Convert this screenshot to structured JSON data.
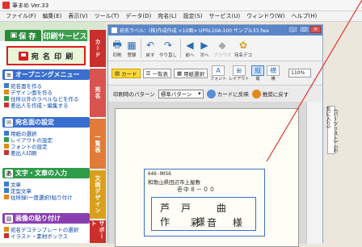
{
  "titlebar": {
    "title": "筆まめ Ver.33"
  },
  "menu": [
    "ファイル(F)",
    "編集(E)",
    "表示(V)",
    "ツール(T)",
    "データ(D)",
    "宛名(L)",
    "設定(S)",
    "サービス(U)",
    "ウィンドウ(W)",
    "ヘルプ(H)"
  ],
  "left": {
    "tab_save": "保 存",
    "tab_print": "印刷サービス",
    "print_button": "宛 名 印 刷",
    "opening_menu": {
      "title": "オープニングメニュー",
      "items": [
        "宛名面を作る",
        "デザイン面を作る",
        "住所以外のラベルなどを作る",
        "差出人を作成・編集する"
      ]
    },
    "address_settings": {
      "title": "宛名面の設定",
      "items": [
        "用紙の選択",
        "レイアウトの設定",
        "フォントの設定",
        "差出人印刷"
      ]
    },
    "text_section": {
      "title": "文字・文章の入力",
      "items": [
        "文章",
        "定型文章",
        "住所録(一度選択)貼り付け"
      ]
    },
    "image_section": {
      "title": "画像の貼り付け",
      "items": [
        "宛名デコテンプレートの選択",
        "イラスト・素材ボックス"
      ]
    },
    "vtabs": [
      "カード",
      "宛名",
      "一覧表",
      "文面デザイン",
      "サポート"
    ]
  },
  "doc": {
    "title": "宛名ラベル：(株)作成作成 <10面> UPRL10A-100 サンプル33.fwa",
    "toolbar": [
      {
        "label": "印刷",
        "icon": "printer-icon",
        "glyph": "🖶",
        "enabled": true
      },
      {
        "label": "登録",
        "icon": "register-icon",
        "glyph": "▦",
        "enabled": true
      },
      {
        "label": "戻す",
        "icon": "undo-icon",
        "glyph": "↶",
        "enabled": true
      },
      {
        "label": "やり直し",
        "icon": "redo-icon",
        "glyph": "↷",
        "enabled": true
      },
      {
        "label": "前へ",
        "icon": "prev-icon",
        "glyph": "◀",
        "enabled": true
      },
      {
        "label": "次へ",
        "icon": "next-icon",
        "glyph": "▶",
        "enabled": true
      },
      {
        "label": "ブラウズ",
        "icon": "browse-icon",
        "glyph": "◆",
        "enabled": false
      },
      {
        "label": "宛名デコ",
        "icon": "deco-icon",
        "glyph": "✿",
        "enabled": true
      }
    ],
    "subbar": {
      "card_label": "カード",
      "list_label": "一覧表",
      "paper_select": "用紙選択",
      "font_label": "フォント",
      "layout_label": "レイアウト",
      "vertical_label": "縦",
      "horizontal_label": "横",
      "zoom": "110%"
    },
    "pattern_label": "印刷時のパターン",
    "pattern_value": "標準パターン",
    "reflect_card": "カードに反映",
    "restore_layout": "推奨に戻す",
    "address": {
      "postal": "646-0056",
      "line1": "和歌山県田辺市上屋敷",
      "line2": "壱中８－００",
      "name1": "芦戸 曲作 様",
      "name2": "彩音 様"
    }
  },
  "right": {
    "favorites": "《パーツリスト》《お気に入り》"
  }
}
